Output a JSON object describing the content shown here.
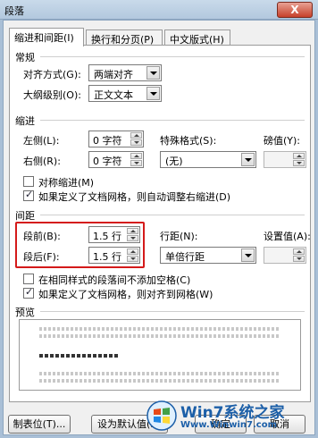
{
  "window": {
    "title": "段落",
    "close_label": "X"
  },
  "tabs": [
    {
      "label": "缩进和间距(I)",
      "active": true
    },
    {
      "label": "换行和分页(P)",
      "active": false
    },
    {
      "label": "中文版式(H)",
      "active": false
    }
  ],
  "general": {
    "title": "常规",
    "alignment_label": "对齐方式(G):",
    "alignment_value": "两端对齐",
    "outline_label": "大纲级别(O):",
    "outline_value": "正文文本"
  },
  "indent": {
    "title": "缩进",
    "left_label": "左侧(L):",
    "left_value": "0 字符",
    "right_label": "右侧(R):",
    "right_value": "0 字符",
    "special_label": "特殊格式(S):",
    "special_value": "(无)",
    "measure_label": "磅值(Y):",
    "measure_value": "",
    "mirror_label": "对称缩进(M)",
    "mirror_checked": false,
    "auto_adjust_label": "如果定义了文档网格，则自动调整右缩进(D)",
    "auto_adjust_checked": true
  },
  "spacing": {
    "title": "间距",
    "before_label": "段前(B):",
    "before_value": "1.5 行",
    "after_label": "段后(F):",
    "after_value": "1.5 行",
    "line_label": "行距(N):",
    "line_value": "单倍行距",
    "at_label": "设置值(A):",
    "at_value": "",
    "no_space_label": "在相同样式的段落间不添加空格(C)",
    "no_space_checked": false,
    "snap_grid_label": "如果定义了文档网格，则对齐到网格(W)",
    "snap_grid_checked": true
  },
  "preview": {
    "title": "预览"
  },
  "buttons": {
    "tabs_label": "制表位(T)...",
    "default_label": "设为默认值(D)",
    "ok_label": "确定",
    "cancel_label": "取消"
  },
  "watermark": {
    "line1": "Win7系统之家",
    "line2": "Www.Winwin7.com"
  },
  "colors": {
    "highlight_border": "#d41a1a",
    "brand": "#1c5fa8"
  }
}
